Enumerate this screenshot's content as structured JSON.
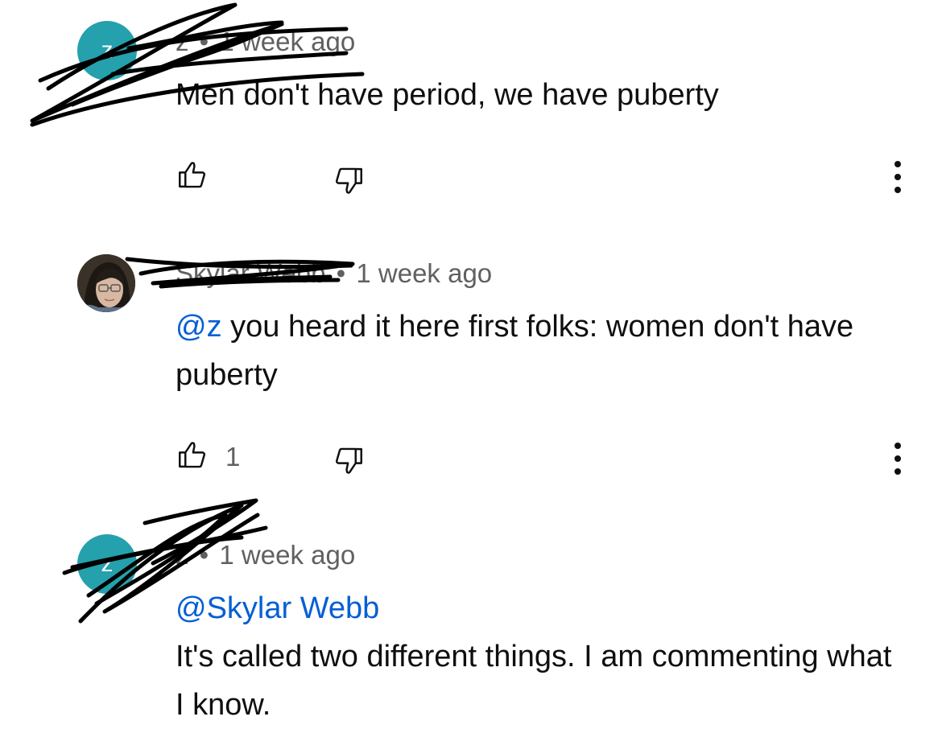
{
  "comments": [
    {
      "author": "z",
      "separator": "•",
      "time": "1 week ago",
      "avatar_letter": "z",
      "mention": "",
      "text": "Men don't have period, we have puberty",
      "likes": ""
    },
    {
      "author": "Skylar Webb",
      "separator": "•",
      "time": "1 week ago",
      "mention": "@z",
      "text": " you heard it here first folks: women don't have puberty",
      "likes": "1"
    },
    {
      "author": "z",
      "separator": "•",
      "time": "1 week ago",
      "avatar_letter": "z",
      "mention": "@Skylar Webb",
      "text": "It's called two different things. I am commenting what I know.",
      "likes": ""
    }
  ],
  "icons": {
    "like": "thumbs-up-icon",
    "dislike": "thumbs-down-icon",
    "more": "more-vertical-icon"
  },
  "colors": {
    "avatar_teal": "#25a0ad",
    "mention_blue": "#065fd4",
    "meta_gray": "#606060",
    "scribble": "#000000"
  }
}
